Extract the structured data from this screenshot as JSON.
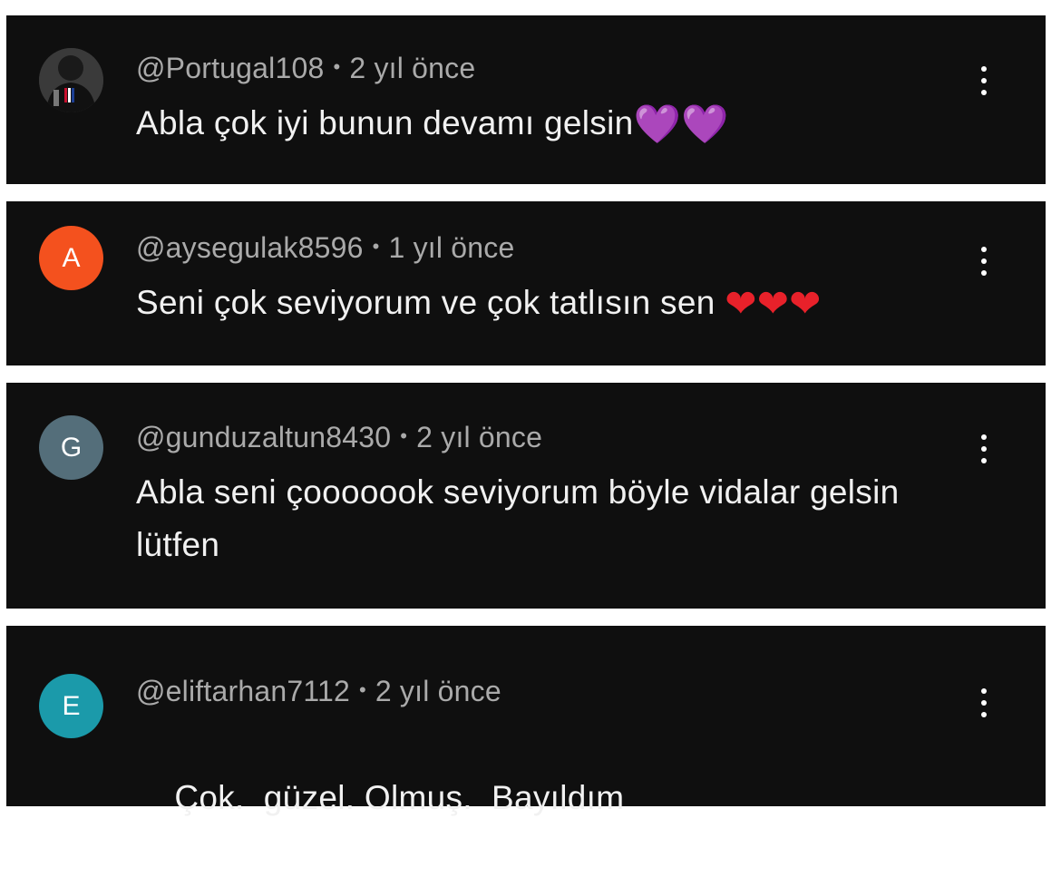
{
  "comments": [
    {
      "username": "@Portugal108",
      "time": "2 yıl önce",
      "text": "Abla çok iyi bunun devamı gelsin",
      "emoji": "💜💜",
      "avatar_letter": "",
      "avatar_color": "#2a2a2a"
    },
    {
      "username": "@aysegulak8596",
      "time": "1 yıl önce",
      "text": "Seni çok seviyorum ve çok tatlısın sen ",
      "emoji": "❤❤❤",
      "avatar_letter": "A",
      "avatar_color": "#f4511e"
    },
    {
      "username": "@gunduzaltun8430",
      "time": "2 yıl önce",
      "text": "Abla seni çooooook seviyorum böyle vidalar gelsin lütfen",
      "emoji": "",
      "avatar_letter": "G",
      "avatar_color": "#546e7a"
    },
    {
      "username": "@eliftarhan7112",
      "time": "2 yıl önce",
      "text": "Çok.  güzel. Olmuş.  Bayıldım",
      "emoji": "",
      "avatar_letter": "E",
      "avatar_color": "#1b9aaa"
    }
  ],
  "separator": "•",
  "colors": {
    "card_background": "#0f0f0f",
    "page_background": "#ffffff",
    "meta_text": "#aaaaaa",
    "comment_text": "#f1f1f1"
  },
  "icons": {
    "menu": "more-vert-icon"
  }
}
